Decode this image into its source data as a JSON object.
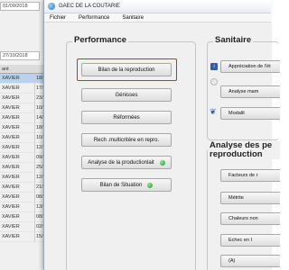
{
  "background": {
    "date_top": "01/09/2018",
    "date_mid": "27/10/2018",
    "column_header": "ant",
    "rows": [
      {
        "name": "XAVIER",
        "value": "18/"
      },
      {
        "name": "XAVIER",
        "value": "17/"
      },
      {
        "name": "XAVIER",
        "value": "23/"
      },
      {
        "name": "XAVIER",
        "value": "10/"
      },
      {
        "name": "XAVIER",
        "value": "14/"
      },
      {
        "name": "XAVIER",
        "value": "18/"
      },
      {
        "name": "XAVIER",
        "value": "10/"
      },
      {
        "name": "XAVIER",
        "value": "12/"
      },
      {
        "name": "XAVIER",
        "value": "09/"
      },
      {
        "name": "XAVIER",
        "value": "25/"
      },
      {
        "name": "XAVIER",
        "value": "12/"
      },
      {
        "name": "XAVIER",
        "value": "21/"
      },
      {
        "name": "XAVIER",
        "value": "08/"
      },
      {
        "name": "XAVIER",
        "value": "13/"
      },
      {
        "name": "XAVIER",
        "value": "08/"
      },
      {
        "name": "XAVIER",
        "value": "02/"
      },
      {
        "name": "XAVIER",
        "value": "15/"
      }
    ]
  },
  "window": {
    "title": "GAEC DE LA COUTARIE"
  },
  "menu": [
    "Fichier",
    "Performance",
    "Sanitaire"
  ],
  "performance": {
    "title": "Performance",
    "buttons": {
      "bilan_repro": "Bilan de la  reproduction",
      "genisses": "Génisses",
      "reformees": "Réformées",
      "rech_multi": "Rech .multicritère en repro.",
      "analyse_prod": "Analyse de la productionlait",
      "bilan_situation": "Bilan de Situation"
    }
  },
  "sanitaire": {
    "title": "Sanitaire",
    "buttons": {
      "appreciation": "Appréciation de l'ét",
      "analyse_mam": "Analyse mam",
      "modalites": "Modalit"
    }
  },
  "reproduction_analysis": {
    "title": "Analyse des pe reproduction",
    "buttons": {
      "facteurs": "Facteurs de r",
      "metrite": "Métrite",
      "chaleurs": "Chaleurs non",
      "echec": "Echec en I",
      "a": "(A)"
    }
  }
}
